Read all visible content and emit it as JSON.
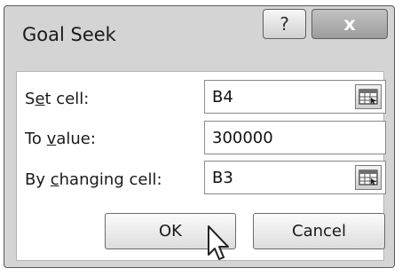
{
  "dialog": {
    "title": "Goal Seek",
    "help_icon": "question-mark-icon",
    "close_icon": "close-x-icon",
    "help_glyph": "?",
    "close_glyph": "x"
  },
  "fields": {
    "set_cell": {
      "label_prefix": "S",
      "label_underlined": "e",
      "label_suffix": "t cell:",
      "value": "B4",
      "icon": "range-selector-icon"
    },
    "to_value": {
      "label_prefix": "To ",
      "label_underlined": "v",
      "label_suffix": "alue:",
      "value": "300000"
    },
    "by_changing": {
      "label_prefix": "By ",
      "label_underlined": "c",
      "label_suffix": "hanging cell:",
      "value": "B3",
      "icon": "range-selector-icon"
    }
  },
  "buttons": {
    "ok": "OK",
    "cancel": "Cancel"
  },
  "cursor": {
    "icon": "mouse-pointer-icon"
  },
  "colors": {
    "dialog_frame": "#d4d4d4",
    "content_bg": "#ffffff",
    "close_button": "#a8a8a8"
  }
}
